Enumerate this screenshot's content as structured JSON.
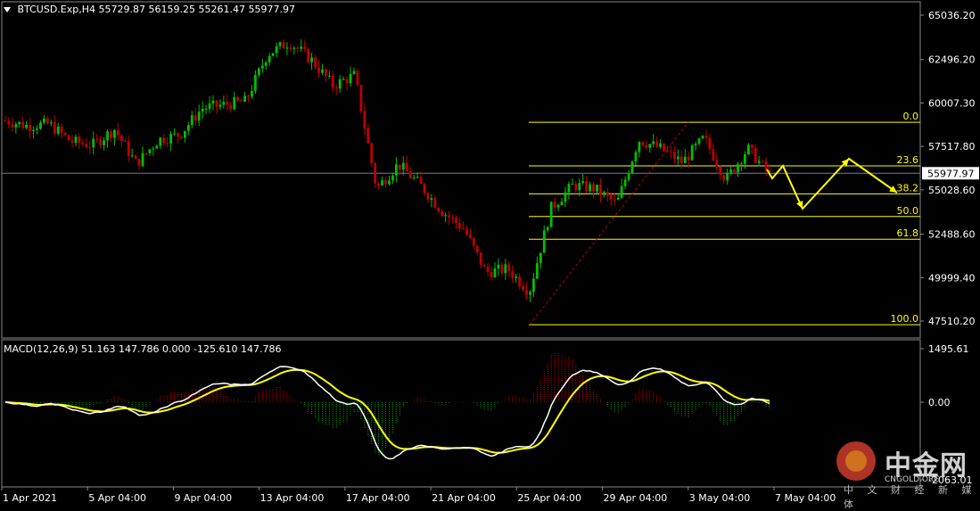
{
  "header": {
    "symbol": "BTCUSD.Exp,H4",
    "open": "55729.87",
    "high": "56159.25",
    "low": "55261.47",
    "close": "55977.97"
  },
  "macd_header": {
    "label": "MACD(12,26,9) 51.163 147.786 0.000 -125.610 147.786"
  },
  "price_axis": {
    "ticks": [
      "65036.20",
      "62496.20",
      "60007.30",
      "57517.80",
      "55028.60",
      "52488.60",
      "49999.40",
      "47510.20"
    ],
    "tick_values": [
      65036.2,
      62496.2,
      60007.3,
      57517.8,
      55028.6,
      52488.6,
      49999.4,
      47510.2
    ],
    "current_price": "55977.97",
    "current_value": 55977.97
  },
  "macd_axis": {
    "ticks": [
      "1495.61",
      "0.00",
      "-2063.01"
    ],
    "tick_values": [
      1495.61,
      0.0,
      -2063.01
    ]
  },
  "time_axis": {
    "labels": [
      "1 Apr 2021",
      "5 Apr 04:00",
      "9 Apr 04:00",
      "13 Apr 04:00",
      "17 Apr 04:00",
      "21 Apr 04:00",
      "25 Apr 04:00",
      "29 Apr 04:00",
      "3 May 04:00",
      "7 May 04:00"
    ]
  },
  "fibonacci": {
    "levels": [
      {
        "label": "0.0",
        "price": 58900
      },
      {
        "label": "23.6",
        "price": 56400
      },
      {
        "label": "38.2",
        "price": 54800
      },
      {
        "label": "50.0",
        "price": 53500
      },
      {
        "label": "61.8",
        "price": 52200
      },
      {
        "label": "100.0",
        "price": 47300
      }
    ]
  },
  "colors": {
    "background": "#000000",
    "bull": "#00c000",
    "bear": "#c00000",
    "fib": "#ffff00",
    "macd_line": "#ffffff",
    "signal_line": "#ffff00",
    "hist_pos": "#c00000",
    "hist_neg": "#00a000",
    "grid_text": "#ffffff",
    "projection": "#ffff00"
  },
  "watermark": {
    "brand": "中金网",
    "domain": "CNGOLD.ORG",
    "tagline": "中 文 财 经 新 媒 体"
  },
  "chart_data": {
    "type": "candlestick",
    "title": "BTCUSD.Exp,H4",
    "xlabel": "",
    "ylabel": "",
    "ylim": [
      47000,
      65800
    ],
    "series": [
      {
        "name": "BTCUSD.Exp,H4",
        "x": [
          "1 Apr 2021",
          "2 Apr",
          "3 Apr",
          "4 Apr",
          "5 Apr 04:00",
          "6 Apr",
          "7 Apr",
          "8 Apr",
          "9 Apr 04:00",
          "10 Apr",
          "11 Apr",
          "12 Apr",
          "13 Apr 04:00",
          "14 Apr",
          "15 Apr",
          "16 Apr",
          "17 Apr 04:00",
          "18 Apr",
          "19 Apr",
          "20 Apr",
          "21 Apr 04:00",
          "22 Apr",
          "23 Apr",
          "24 Apr",
          "25 Apr 04:00",
          "26 Apr",
          "27 Apr",
          "28 Apr",
          "29 Apr 04:00",
          "30 Apr",
          "1 May",
          "2 May",
          "3 May 04:00",
          "4 May",
          "5 May",
          "6 May"
        ],
        "close": [
          59000,
          58700,
          58800,
          57800,
          57600,
          58500,
          56500,
          57900,
          58200,
          59700,
          59900,
          60100,
          62800,
          63500,
          62500,
          61000,
          61600,
          55100,
          56500,
          55300,
          53800,
          52800,
          50300,
          50500,
          49200,
          54000,
          55300,
          55100,
          54200,
          57900,
          57400,
          56600,
          58000,
          55600,
          57400,
          55900
        ]
      }
    ],
    "macd": {
      "name": "MACD(12,26,9)",
      "values": [
        51.163,
        147.786,
        0.0,
        -125.61,
        147.786
      ]
    }
  }
}
